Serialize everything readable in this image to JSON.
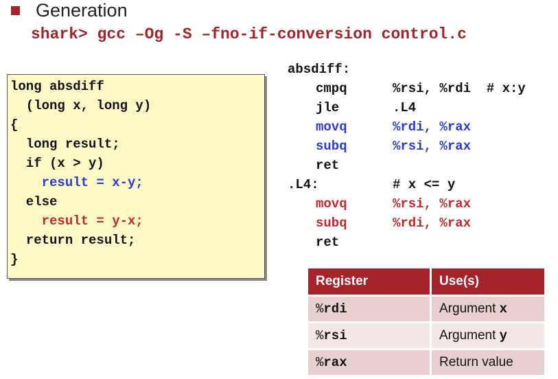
{
  "heading": "Generation",
  "command": "shark> gcc –Og -S –fno-if-conversion control.c",
  "c_code": [
    {
      "text": "long absdiff",
      "color": "default",
      "indent": 0
    },
    {
      "text": "  (long x, long y)",
      "color": "default",
      "indent": 0
    },
    {
      "text": "{",
      "color": "default",
      "indent": 0
    },
    {
      "text": "  long result;",
      "color": "default",
      "indent": 0
    },
    {
      "text": "  if (x > y)",
      "color": "default",
      "indent": 0
    },
    {
      "text": "    result = x-y;",
      "color": "blue",
      "indent": 0
    },
    {
      "text": "  else",
      "color": "default",
      "indent": 0
    },
    {
      "text": "    result = y-x;",
      "color": "red",
      "indent": 0
    },
    {
      "text": "  return result;",
      "color": "default",
      "indent": 0
    },
    {
      "text": "}",
      "color": "default",
      "indent": 0
    }
  ],
  "asm": [
    {
      "label": "absdiff:",
      "op": "",
      "args": "",
      "color": "default"
    },
    {
      "label": "",
      "op": "cmpq",
      "args": "%rsi, %rdi  # x:y",
      "color": "default"
    },
    {
      "label": "",
      "op": "jle",
      "args": ".L4",
      "color": "default"
    },
    {
      "label": "",
      "op": "movq",
      "args": "%rdi, %rax",
      "color": "blue"
    },
    {
      "label": "",
      "op": "subq",
      "args": "%rsi, %rax",
      "color": "blue"
    },
    {
      "label": "",
      "op": "ret",
      "args": "",
      "color": "default"
    },
    {
      "label": ".L4:",
      "op": "",
      "args": "# x <= y",
      "color": "default"
    },
    {
      "label": "",
      "op": "movq",
      "args": "%rsi, %rax",
      "color": "red"
    },
    {
      "label": "",
      "op": "subq",
      "args": "%rdi, %rax",
      "color": "red"
    },
    {
      "label": "",
      "op": "ret",
      "args": "",
      "color": "default"
    }
  ],
  "table": {
    "headers": [
      "Register",
      "Use(s)"
    ],
    "rows": [
      {
        "reg_prefix": "%",
        "reg_name": "rdi",
        "use_text": "Argument ",
        "use_var": "x"
      },
      {
        "reg_prefix": "%",
        "reg_name": "rsi",
        "use_text": "Argument ",
        "use_var": "y"
      },
      {
        "reg_prefix": "%",
        "reg_name": "rax",
        "use_text": "Return value",
        "use_var": ""
      }
    ]
  },
  "colors": {
    "accent": "#a5232a",
    "blue": "#2a3bd1",
    "red": "#c2282b",
    "code_bg": "#fdf9c6"
  }
}
